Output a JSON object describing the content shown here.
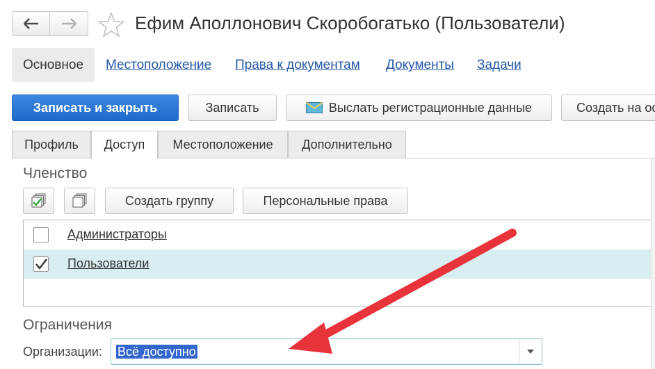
{
  "window": {
    "title": "Ефим Аполлонович Скоробогатько (Пользователи)"
  },
  "nav_links": {
    "main": "Основное",
    "location": "Местоположение",
    "doc_rights": "Права к документам",
    "documents": "Документы",
    "tasks": "Задачи"
  },
  "toolbar": {
    "save_close": "Записать и закрыть",
    "save": "Записать",
    "send_reg": "Выслать регистрационные данные",
    "create_on": "Создать на основании"
  },
  "tabs": [
    "Профиль",
    "Доступ",
    "Местоположение",
    "Дополнительно"
  ],
  "membership": {
    "heading": "Членство",
    "create_group": "Создать группу",
    "personal_rights": "Персональные права",
    "rows": [
      {
        "label": "Администраторы",
        "checked": false
      },
      {
        "label": "Пользователи",
        "checked": true
      }
    ]
  },
  "restrictions": {
    "heading": "Ограничения",
    "org_label": "Организации:",
    "org_value": "Всё доступно"
  },
  "colors": {
    "primary": "#2a74d4",
    "link": "#2458a7",
    "selected_row": "#d9eef1",
    "annotation_arrow": "#e8333a"
  }
}
